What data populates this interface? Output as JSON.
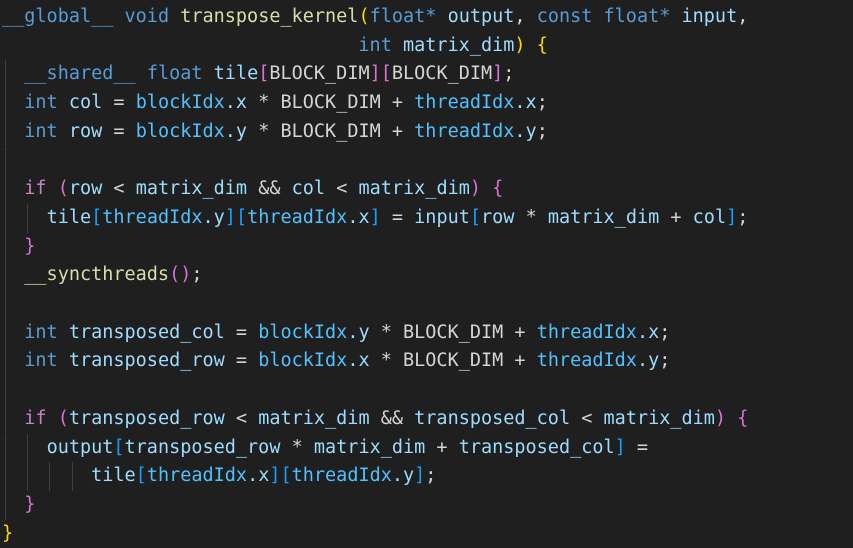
{
  "editor": {
    "language": "cuda",
    "colors": {
      "background": "#1f1f1f",
      "keyword": "#569cd6",
      "control_keyword": "#c586c0",
      "function": "#dcdcaa",
      "variable": "#9cdcfe",
      "builtin": "#4fc1ff",
      "plain": "#d4d4d4",
      "bracket_level_1": "#ffd700",
      "bracket_level_2": "#da70d6",
      "bracket_level_3": "#179fff",
      "indent_guide": "#404040"
    },
    "lines": [
      {
        "indent": 0,
        "tokens": [
          {
            "t": "__global__",
            "c": "kw"
          },
          {
            "t": " ",
            "c": "op"
          },
          {
            "t": "void",
            "c": "kw"
          },
          {
            "t": " ",
            "c": "op"
          },
          {
            "t": "transpose_kernel",
            "c": "fn"
          },
          {
            "t": "(",
            "c": "b1"
          },
          {
            "t": "float",
            "c": "kw"
          },
          {
            "t": "*",
            "c": "kw"
          },
          {
            "t": " ",
            "c": "op"
          },
          {
            "t": "output",
            "c": "var"
          },
          {
            "t": ", ",
            "c": "op"
          },
          {
            "t": "const",
            "c": "kw"
          },
          {
            "t": " ",
            "c": "op"
          },
          {
            "t": "float",
            "c": "kw"
          },
          {
            "t": "*",
            "c": "kw"
          },
          {
            "t": " ",
            "c": "op"
          },
          {
            "t": "input",
            "c": "var"
          },
          {
            "t": ",",
            "c": "op"
          }
        ]
      },
      {
        "indent": 0,
        "tokens": [
          {
            "t": "                                ",
            "c": "op"
          },
          {
            "t": "int",
            "c": "kw"
          },
          {
            "t": " ",
            "c": "op"
          },
          {
            "t": "matrix_dim",
            "c": "var"
          },
          {
            "t": ")",
            "c": "b1"
          },
          {
            "t": " ",
            "c": "op"
          },
          {
            "t": "{",
            "c": "b1"
          }
        ]
      },
      {
        "indent": 1,
        "tokens": [
          {
            "t": "__shared__",
            "c": "kw"
          },
          {
            "t": " ",
            "c": "op"
          },
          {
            "t": "float",
            "c": "kw"
          },
          {
            "t": " ",
            "c": "op"
          },
          {
            "t": "tile",
            "c": "var"
          },
          {
            "t": "[",
            "c": "b2"
          },
          {
            "t": "BLOCK_DIM",
            "c": "ident"
          },
          {
            "t": "]",
            "c": "b2"
          },
          {
            "t": "[",
            "c": "b2"
          },
          {
            "t": "BLOCK_DIM",
            "c": "ident"
          },
          {
            "t": "]",
            "c": "b2"
          },
          {
            "t": ";",
            "c": "op"
          }
        ]
      },
      {
        "indent": 1,
        "tokens": [
          {
            "t": "int",
            "c": "kw"
          },
          {
            "t": " ",
            "c": "op"
          },
          {
            "t": "col",
            "c": "var"
          },
          {
            "t": " = ",
            "c": "op"
          },
          {
            "t": "blockIdx",
            "c": "builtin"
          },
          {
            "t": ".x",
            "c": "var"
          },
          {
            "t": " * ",
            "c": "op"
          },
          {
            "t": "BLOCK_DIM",
            "c": "ident"
          },
          {
            "t": " + ",
            "c": "op"
          },
          {
            "t": "threadIdx",
            "c": "builtin"
          },
          {
            "t": ".x",
            "c": "var"
          },
          {
            "t": ";",
            "c": "op"
          }
        ]
      },
      {
        "indent": 1,
        "tokens": [
          {
            "t": "int",
            "c": "kw"
          },
          {
            "t": " ",
            "c": "op"
          },
          {
            "t": "row",
            "c": "var"
          },
          {
            "t": " = ",
            "c": "op"
          },
          {
            "t": "blockIdx",
            "c": "builtin"
          },
          {
            "t": ".y",
            "c": "var"
          },
          {
            "t": " * ",
            "c": "op"
          },
          {
            "t": "BLOCK_DIM",
            "c": "ident"
          },
          {
            "t": " + ",
            "c": "op"
          },
          {
            "t": "threadIdx",
            "c": "builtin"
          },
          {
            "t": ".y",
            "c": "var"
          },
          {
            "t": ";",
            "c": "op"
          }
        ]
      },
      {
        "indent": 1,
        "tokens": []
      },
      {
        "indent": 1,
        "tokens": [
          {
            "t": "if",
            "c": "ctrl"
          },
          {
            "t": " ",
            "c": "op"
          },
          {
            "t": "(",
            "c": "b2"
          },
          {
            "t": "row",
            "c": "var"
          },
          {
            "t": " < ",
            "c": "op"
          },
          {
            "t": "matrix_dim",
            "c": "var"
          },
          {
            "t": " && ",
            "c": "op"
          },
          {
            "t": "col",
            "c": "var"
          },
          {
            "t": " < ",
            "c": "op"
          },
          {
            "t": "matrix_dim",
            "c": "var"
          },
          {
            "t": ")",
            "c": "b2"
          },
          {
            "t": " ",
            "c": "op"
          },
          {
            "t": "{",
            "c": "b2"
          }
        ]
      },
      {
        "indent": 2,
        "tokens": [
          {
            "t": "tile",
            "c": "var"
          },
          {
            "t": "[",
            "c": "b3"
          },
          {
            "t": "threadIdx",
            "c": "builtin"
          },
          {
            "t": ".y",
            "c": "var"
          },
          {
            "t": "]",
            "c": "b3"
          },
          {
            "t": "[",
            "c": "b3"
          },
          {
            "t": "threadIdx",
            "c": "builtin"
          },
          {
            "t": ".x",
            "c": "var"
          },
          {
            "t": "]",
            "c": "b3"
          },
          {
            "t": " = ",
            "c": "op"
          },
          {
            "t": "input",
            "c": "var"
          },
          {
            "t": "[",
            "c": "b3"
          },
          {
            "t": "row",
            "c": "var"
          },
          {
            "t": " * ",
            "c": "op"
          },
          {
            "t": "matrix_dim",
            "c": "var"
          },
          {
            "t": " + ",
            "c": "op"
          },
          {
            "t": "col",
            "c": "var"
          },
          {
            "t": "]",
            "c": "b3"
          },
          {
            "t": ";",
            "c": "op"
          }
        ]
      },
      {
        "indent": 1,
        "tokens": [
          {
            "t": "}",
            "c": "b2"
          }
        ]
      },
      {
        "indent": 1,
        "tokens": [
          {
            "t": "__syncthreads",
            "c": "fn"
          },
          {
            "t": "()",
            "c": "b2"
          },
          {
            "t": ";",
            "c": "op"
          }
        ]
      },
      {
        "indent": 1,
        "tokens": []
      },
      {
        "indent": 1,
        "tokens": [
          {
            "t": "int",
            "c": "kw"
          },
          {
            "t": " ",
            "c": "op"
          },
          {
            "t": "transposed_col",
            "c": "var"
          },
          {
            "t": " = ",
            "c": "op"
          },
          {
            "t": "blockIdx",
            "c": "builtin"
          },
          {
            "t": ".y",
            "c": "var"
          },
          {
            "t": " * ",
            "c": "op"
          },
          {
            "t": "BLOCK_DIM",
            "c": "ident"
          },
          {
            "t": " + ",
            "c": "op"
          },
          {
            "t": "threadIdx",
            "c": "builtin"
          },
          {
            "t": ".x",
            "c": "var"
          },
          {
            "t": ";",
            "c": "op"
          }
        ]
      },
      {
        "indent": 1,
        "tokens": [
          {
            "t": "int",
            "c": "kw"
          },
          {
            "t": " ",
            "c": "op"
          },
          {
            "t": "transposed_row",
            "c": "var"
          },
          {
            "t": " = ",
            "c": "op"
          },
          {
            "t": "blockIdx",
            "c": "builtin"
          },
          {
            "t": ".x",
            "c": "var"
          },
          {
            "t": " * ",
            "c": "op"
          },
          {
            "t": "BLOCK_DIM",
            "c": "ident"
          },
          {
            "t": " + ",
            "c": "op"
          },
          {
            "t": "threadIdx",
            "c": "builtin"
          },
          {
            "t": ".y",
            "c": "var"
          },
          {
            "t": ";",
            "c": "op"
          }
        ]
      },
      {
        "indent": 1,
        "tokens": []
      },
      {
        "indent": 1,
        "tokens": [
          {
            "t": "if",
            "c": "ctrl"
          },
          {
            "t": " ",
            "c": "op"
          },
          {
            "t": "(",
            "c": "b2"
          },
          {
            "t": "transposed_row",
            "c": "var"
          },
          {
            "t": " < ",
            "c": "op"
          },
          {
            "t": "matrix_dim",
            "c": "var"
          },
          {
            "t": " && ",
            "c": "op"
          },
          {
            "t": "transposed_col",
            "c": "var"
          },
          {
            "t": " < ",
            "c": "op"
          },
          {
            "t": "matrix_dim",
            "c": "var"
          },
          {
            "t": ")",
            "c": "b2"
          },
          {
            "t": " ",
            "c": "op"
          },
          {
            "t": "{",
            "c": "b2"
          }
        ]
      },
      {
        "indent": 2,
        "tokens": [
          {
            "t": "output",
            "c": "var"
          },
          {
            "t": "[",
            "c": "b3"
          },
          {
            "t": "transposed_row",
            "c": "var"
          },
          {
            "t": " * ",
            "c": "op"
          },
          {
            "t": "matrix_dim",
            "c": "var"
          },
          {
            "t": " + ",
            "c": "op"
          },
          {
            "t": "transposed_col",
            "c": "var"
          },
          {
            "t": "]",
            "c": "b3"
          },
          {
            "t": " =",
            "c": "op"
          }
        ]
      },
      {
        "indent": 4,
        "tokens": [
          {
            "t": "tile",
            "c": "var"
          },
          {
            "t": "[",
            "c": "b3"
          },
          {
            "t": "threadIdx",
            "c": "builtin"
          },
          {
            "t": ".x",
            "c": "var"
          },
          {
            "t": "]",
            "c": "b3"
          },
          {
            "t": "[",
            "c": "b3"
          },
          {
            "t": "threadIdx",
            "c": "builtin"
          },
          {
            "t": ".y",
            "c": "var"
          },
          {
            "t": "]",
            "c": "b3"
          },
          {
            "t": ";",
            "c": "op"
          }
        ]
      },
      {
        "indent": 1,
        "tokens": [
          {
            "t": "}",
            "c": "b2"
          }
        ]
      },
      {
        "indent": 0,
        "tokens": [
          {
            "t": "}",
            "c": "b1"
          }
        ]
      }
    ]
  }
}
